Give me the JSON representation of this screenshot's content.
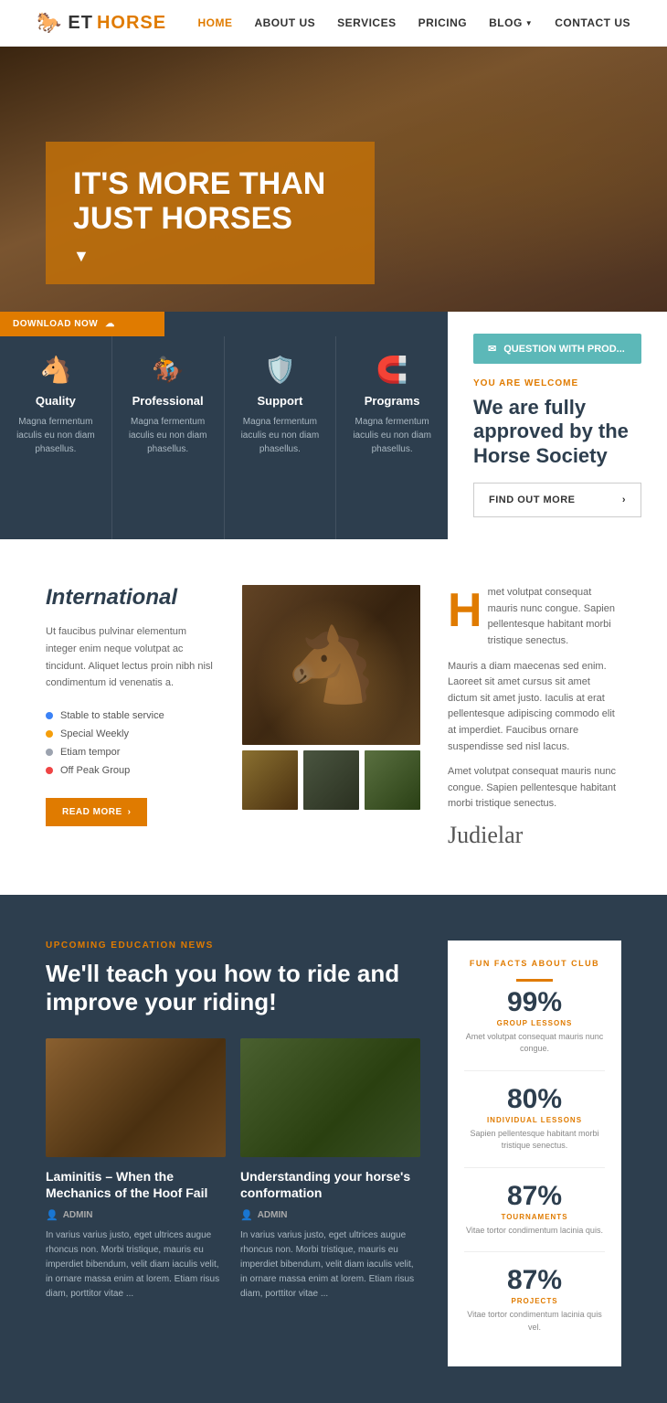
{
  "navbar": {
    "logo": {
      "icon": "🐎",
      "et": "ET",
      "horse": "HORSE"
    },
    "links": [
      {
        "label": "HOME",
        "active": true
      },
      {
        "label": "ABOUT US",
        "active": false
      },
      {
        "label": "SERVICES",
        "active": false
      },
      {
        "label": "PRICING",
        "active": false
      },
      {
        "label": "BLOG",
        "active": false,
        "hasDropdown": true
      },
      {
        "label": "CONTACT US",
        "active": false
      }
    ]
  },
  "hero": {
    "title": "IT'S MORE THAN JUST HORSES"
  },
  "download_bar": {
    "label": "DOWNLOAD NOW",
    "icon": "☁"
  },
  "feature_cards": [
    {
      "icon": "🐴",
      "title": "Quality",
      "desc": "Magna fermentum iaculis eu non diam phasellus."
    },
    {
      "icon": "🏇",
      "title": "Professional",
      "desc": "Magna fermentum iaculis eu non diam phasellus."
    },
    {
      "icon": "🛡️",
      "title": "Support",
      "desc": "Magna fermentum iaculis eu non diam phasellus."
    },
    {
      "icon": "🧲",
      "title": "Programs",
      "desc": "Magna fermentum iaculis eu non diam phasellus."
    }
  ],
  "approved": {
    "question_btn": "QUESTION WITH PROD...",
    "you_welcome": "YOU ARE WELCOME",
    "title": "We are fully approved by the Horse Society",
    "find_out": "FIND OUT MORE"
  },
  "international": {
    "title": "International",
    "desc": "Ut faucibus pulvinar elementum integer enim neque volutpat ac tincidunt. Aliquet lectus proin nibh nisl condimentum id venenatis a.",
    "list": [
      {
        "color": "blue",
        "label": "Stable to stable service"
      },
      {
        "color": "orange",
        "label": "Special Weekly"
      },
      {
        "color": "gray",
        "label": "Etiam tempor"
      },
      {
        "color": "red",
        "label": "Off Peak Group"
      }
    ],
    "read_more": "READ MORE",
    "body_text": "met volutpat consequat mauris nunc congue. Sapien pellentesque habitant morbi tristique senectus.",
    "body_text2": "Mauris a diam maecenas sed enim. Laoreet sit amet cursus sit amet dictum sit amet justo. Iaculis at erat pellentesque adipiscing commodo elit at imperdiet. Faucibus ornare suspendisse sed nisl lacus.",
    "body_text3": "Amet volutpat consequat mauris nunc congue. Sapien pellentesque habitant morbi tristique senectus.",
    "signature": "Judielar"
  },
  "education": {
    "label": "UPCOMING EDUCATION NEWS",
    "title": "We'll teach you how to ride and improve your riding!",
    "cards": [
      {
        "title": "Laminitis – When the Mechanics of the Hoof Fail",
        "admin": "ADMIN",
        "desc": "In varius varius justo, eget ultrices augue rhoncus non. Morbi tristique, mauris eu imperdiet bibendum, velit diam iaculis velit, in ornare massa enim at lorem. Etiam risus diam, porttitor vitae ..."
      },
      {
        "title": "Understanding your horse's conformation",
        "admin": "ADMIN",
        "desc": "In varius varius justo, eget ultrices augue rhoncus non. Morbi tristique, mauris eu imperdiet bibendum, velit diam iaculis velit, in ornare massa enim at lorem. Etiam risus diam, porttitor vitae ..."
      }
    ]
  },
  "facts": {
    "label": "FUN FACTS ABOUT CLUB",
    "items": [
      {
        "percent": "99%",
        "name": "GROUP LESSONS",
        "desc": "Amet volutpat consequat mauris nunc congue."
      },
      {
        "percent": "80%",
        "name": "INDIVIDUAL LESSONS",
        "desc": "Sapien pellentesque habitant morbi tristique senectus."
      },
      {
        "percent": "87%",
        "name": "TOURNAMENTS",
        "desc": "Vitae tortor condimentum lacinia quis."
      },
      {
        "percent": "87%",
        "name": "PROJECTS",
        "desc": "Vitae tortor condimentum lacinia quis vel."
      }
    ]
  }
}
